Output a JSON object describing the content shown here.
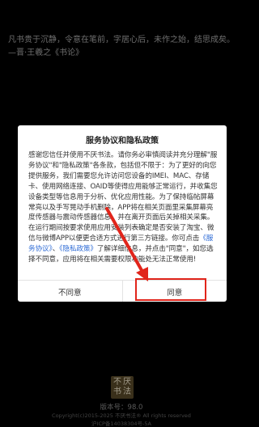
{
  "splash": {
    "quote": "凡书贵于沉静，令意在笔前，字居心后，未作之始，结思成矣。 —晋·王羲之《书论》",
    "version": "版本号：98.0",
    "copyright": "Copyright(c)2015-2025 不厌书法® All rights reserved",
    "icp": "沪ICP备14038304号-5A",
    "logo_chars": [
      "不",
      "厌",
      "书",
      "法"
    ]
  },
  "dialog": {
    "title": "服务协议和隐私政策",
    "body_1": "感谢您信任并使用不厌书法。请你务必审慎阅读并充分理解\"服务协议\"和\"隐私政策\"各条款，包括但不限于：为了更好的向您提供服务，我们需要您允许访问您设备的IMEI、MAC、存储卡、使用网络连接、OAID等使得应用能够正常运行，并收集您设备类型等信息用于分析、优化应用性能。为了保持临帖屏幕常亮以及手写晃动手机删除，APP将在相关页面里采集屏幕亮度传感器与震动传感器信息，并在离开页面后关掉相关采集。在运行期间按要求使用应用安装列表确定是否安装了淘宝、微信与微博APP以便更合适方式进行第三方链接。你可点击",
    "link_service": "《服务协议》",
    "body_2": "、",
    "link_privacy": "《隐私政策》",
    "body_3": "了解详细信息，并点击\"同意\"，如您选择不同意，应用将在相关需要权限功能处无法正常使用!",
    "disagree_label": "不同意",
    "agree_label": "同意"
  },
  "colors": {
    "link": "#2f6cd6",
    "highlight": "#e1251b"
  }
}
